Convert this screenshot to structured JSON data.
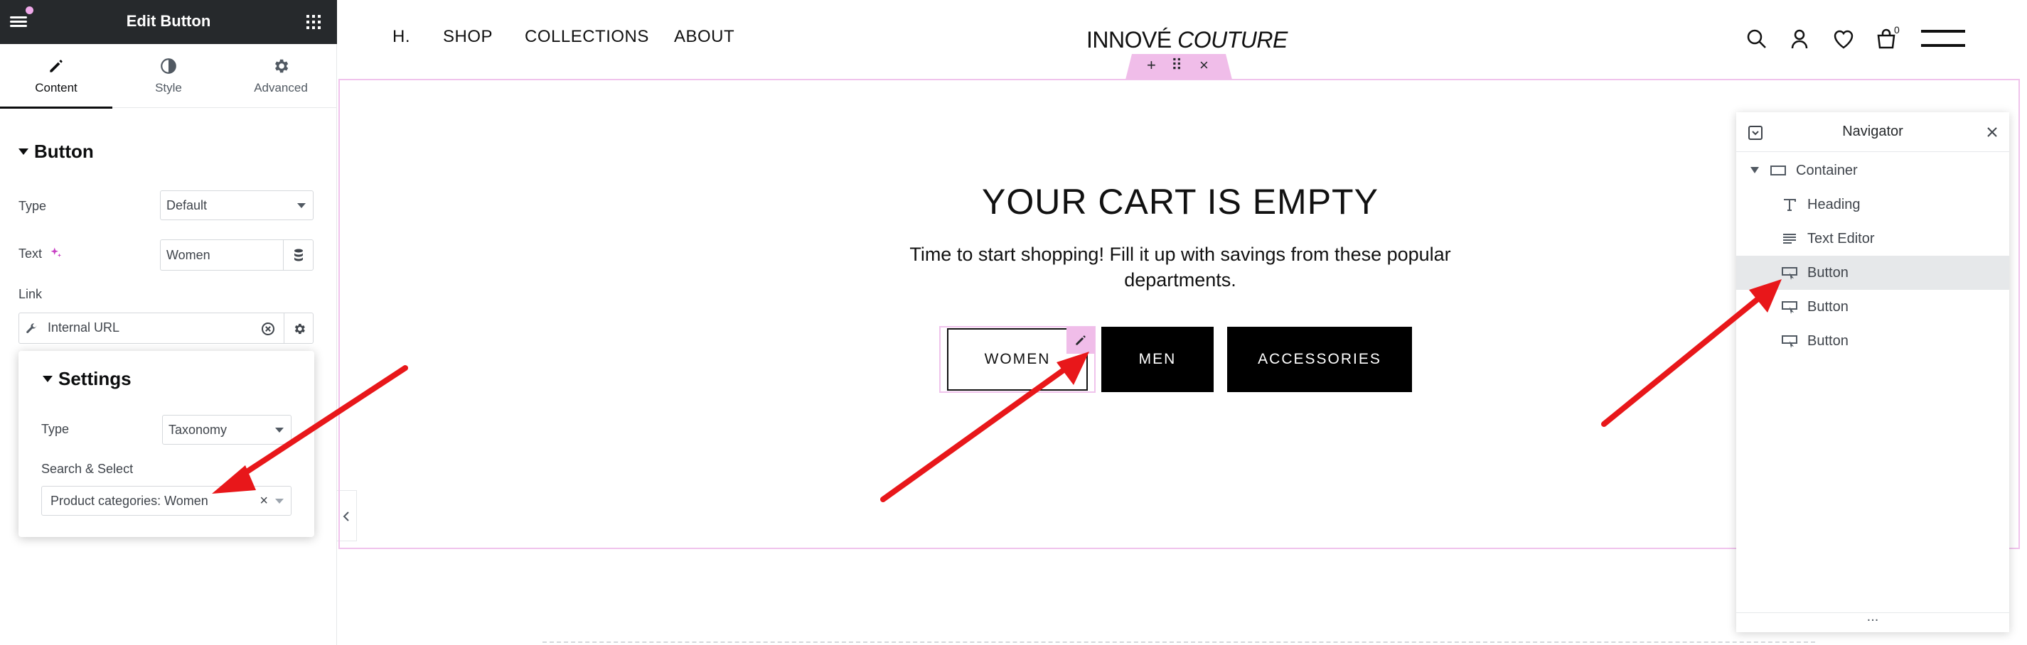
{
  "editor": {
    "title": "Edit Button",
    "tabs": [
      {
        "label": "Content",
        "icon": "pencil-icon"
      },
      {
        "label": "Style",
        "icon": "half-circle-icon"
      },
      {
        "label": "Advanced",
        "icon": "gear-icon"
      }
    ],
    "section_title": "Button",
    "fields": {
      "type_label": "Type",
      "type_value": "Default",
      "text_label": "Text",
      "text_value": "Women",
      "link_label": "Link",
      "link_value": "Internal URL"
    },
    "settings": {
      "title": "Settings",
      "type_label": "Type",
      "type_value": "Taxonomy",
      "search_label": "Search & Select",
      "search_value": "Product categories: Women",
      "clear_glyph": "×"
    }
  },
  "site": {
    "nav": [
      "H.",
      "SHOP",
      "COLLECTIONS",
      "ABOUT"
    ],
    "logo_main": "INNOVÉ",
    "logo_italic": "COUTURE",
    "cart_badge": "0",
    "edit_handle": {
      "add": "+",
      "move": "⠿",
      "close": "×"
    },
    "cart_title": "YOUR CART IS EMPTY",
    "cart_subtitle": "Time to start shopping! Fill it up with savings from these popular departments.",
    "buttons": [
      "WOMEN",
      "MEN",
      "ACCESSORIES"
    ]
  },
  "navigator": {
    "title": "Navigator",
    "items": [
      {
        "label": "Container",
        "icon": "container-icon"
      },
      {
        "label": "Heading",
        "icon": "heading-icon"
      },
      {
        "label": "Text Editor",
        "icon": "text-editor-icon"
      },
      {
        "label": "Button",
        "icon": "button-icon",
        "selected": true
      },
      {
        "label": "Button",
        "icon": "button-icon"
      },
      {
        "label": "Button",
        "icon": "button-icon"
      }
    ],
    "footer": "..."
  },
  "colors": {
    "panel_header": "#26292c",
    "accent_pink": "#f0bde9",
    "arrow_red": "#e8171a",
    "button_black": "#000000"
  }
}
